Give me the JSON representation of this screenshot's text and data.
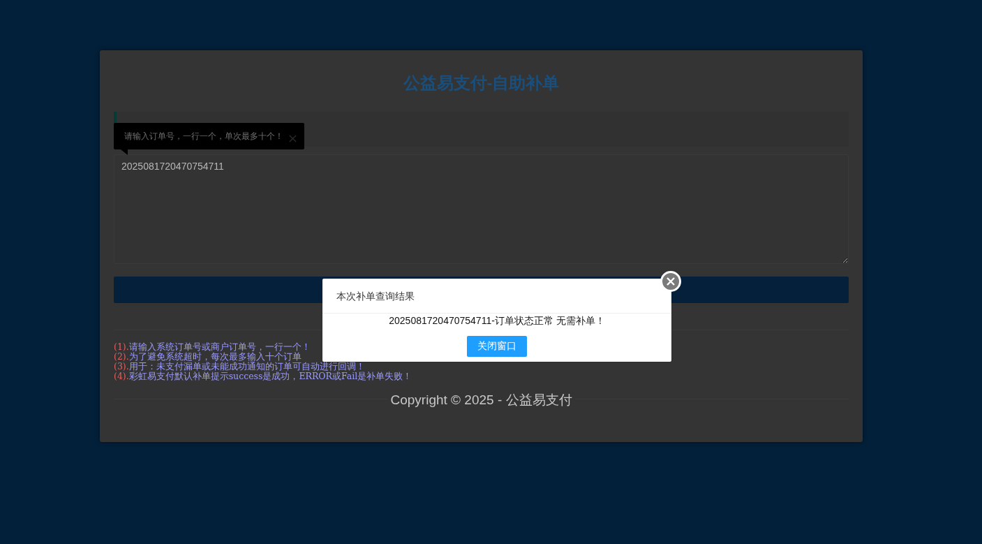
{
  "page_title": "公益易支付-自助补单",
  "tooltip": {
    "text": "请输入订单号，一行一个，单次最多十个！"
  },
  "order_input": {
    "value": "2025081720470754711"
  },
  "notes": [
    {
      "number": "(1).",
      "text": "请输入系统订单号或商户订单号，一行一个！"
    },
    {
      "number": "(2).",
      "text": "为了避免系统超时，每次最多输入十个订单"
    },
    {
      "number": "(3).",
      "text": "用于：未支付漏单或未能成功通知的订单可自动进行回调！"
    },
    {
      "number": "(4).",
      "text": "彩虹易支付默认补单提示success是成功，ERROR或Fail是补单失败！"
    }
  ],
  "copyright": "Copyright © 2025 - 公益易支付",
  "dialog": {
    "title": "本次补单查询结果",
    "message": "2025081720470754711-订单状态正常 无需补单！",
    "button": "关闭窗口"
  }
}
